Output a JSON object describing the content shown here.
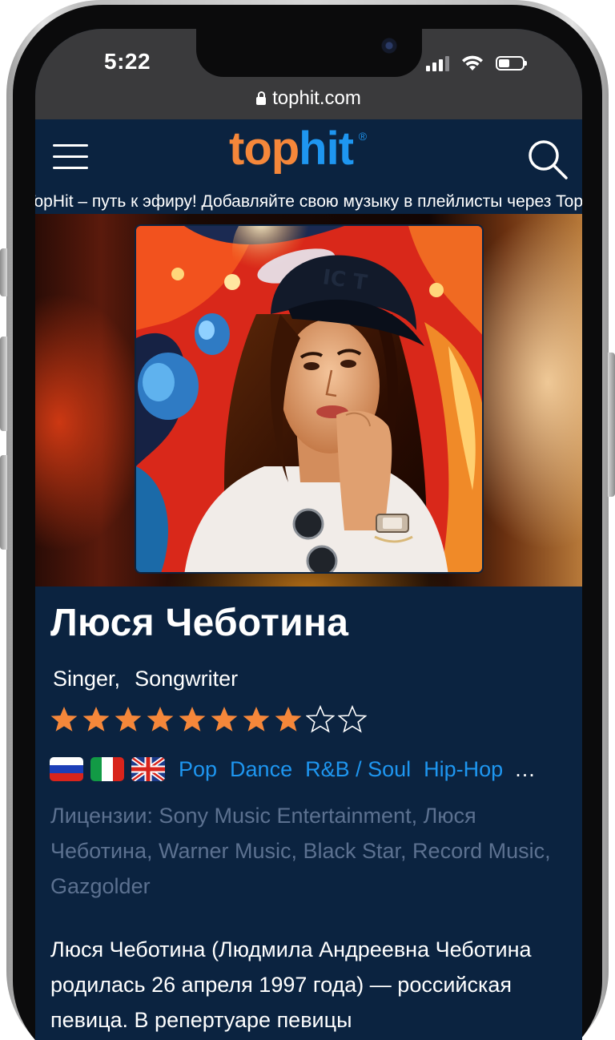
{
  "status_bar": {
    "time": "5:22",
    "battery_level": 0.45
  },
  "browser": {
    "url": "tophit.com"
  },
  "header": {
    "logo_top": "top",
    "logo_hit": "hit",
    "logo_mark": "®",
    "menu_icon": "hamburger-menu-icon",
    "search_icon": "search-icon"
  },
  "ticker": {
    "text": "TopHit – путь к эфиру! Добавляйте свою музыку в плейлисты через TopHit"
  },
  "artist": {
    "name": "Люся Чеботина",
    "roles": [
      "Singer,",
      "Songwriter"
    ],
    "rating": {
      "filled": 8,
      "total": 10
    },
    "flags": [
      "russia-flag",
      "italy-flag",
      "uk-flag"
    ],
    "genres": [
      "Pop",
      "Dance",
      "R&B / Soul",
      "Hip-Hop"
    ],
    "more": "...",
    "licenses": "Лицензии: Sony Music Entertainment, Люся Чеботина, Warner Music, Black Star, Record Music, Gazgolder",
    "bio": "Люся Чеботина (Людмила Андреевна Чеботина родилась 26 апреля 1997 года) — российская певица. В репертуаре певицы"
  },
  "colors": {
    "background": "#0b2340",
    "accent_orange": "#f5873a",
    "accent_blue": "#1e96f0",
    "muted_text": "#5c7190",
    "chrome": "#3a3a3c"
  }
}
